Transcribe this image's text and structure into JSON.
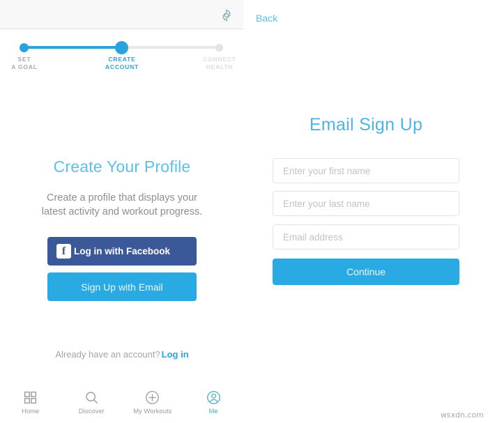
{
  "left_panel": {
    "gear_icon": "gear-icon",
    "stepper": {
      "steps": [
        {
          "label_line1": "SET",
          "label_line2": "A GOAL",
          "state": "done"
        },
        {
          "label_line1": "CREATE",
          "label_line2": "ACCOUNT",
          "state": "active"
        },
        {
          "label_line1": "CONNECT",
          "label_line2": "HEALTH",
          "state": "todo"
        }
      ]
    },
    "profile": {
      "title": "Create Your Profile",
      "subtitle_line1": "Create a profile that displays your",
      "subtitle_line2": "latest activity and workout progress.",
      "facebook_button": "Log in with Facebook",
      "facebook_icon_letter": "f",
      "email_button": "Sign Up with Email"
    },
    "footer": {
      "prompt": "Already have an account?",
      "login_link": "Log in"
    },
    "tabbar": [
      {
        "label": "Home",
        "icon": "grid-icon",
        "active": false
      },
      {
        "label": "Discover",
        "icon": "search-icon",
        "active": false
      },
      {
        "label": "My Workouts",
        "icon": "plus-circle-icon",
        "active": false
      },
      {
        "label": "Me",
        "icon": "person-circle-icon",
        "active": true
      }
    ]
  },
  "right_panel": {
    "back_label": "Back",
    "title": "Email Sign Up",
    "fields": [
      {
        "placeholder": "Enter your first name",
        "value": ""
      },
      {
        "placeholder": "Enter your last name",
        "value": ""
      },
      {
        "placeholder": "Email address",
        "value": ""
      }
    ],
    "continue_button": "Continue"
  },
  "watermark": "wsxdn.com",
  "colors": {
    "accent_blue": "#29aae3",
    "light_blue": "#5bc2e7",
    "facebook_blue": "#3b5998",
    "muted_gray": "#9b9b9b",
    "teal_active": "#45b0c8"
  }
}
